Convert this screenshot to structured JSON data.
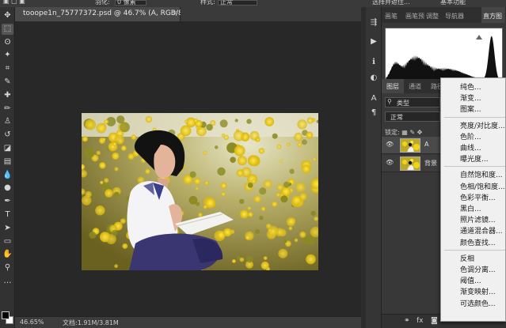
{
  "options_bar": {
    "feather_label": "羽化:",
    "feather_value": "0 像素",
    "style_label": "样式:",
    "style_value": "正常",
    "select_mask_button": "选择并遮住...",
    "workspace_value": "基本功能"
  },
  "document": {
    "tab_title": "tooope1n_75777372.psd @ 46.7% (A, RGB/8#) *",
    "close_glyph": "×"
  },
  "status": {
    "zoom": "46.65%",
    "doc_info": "文档:1.91M/3.81M"
  },
  "toolbar": {
    "tools": [
      {
        "name": "move-tool-icon",
        "glyph": "✥"
      },
      {
        "name": "marquee-tool-icon",
        "glyph": "⬚"
      },
      {
        "name": "lasso-tool-icon",
        "glyph": "ʘ"
      },
      {
        "name": "magic-wand-tool-icon",
        "glyph": "✦"
      },
      {
        "name": "crop-tool-icon",
        "glyph": "⌗"
      },
      {
        "name": "eyedropper-tool-icon",
        "glyph": "✎"
      },
      {
        "name": "healing-brush-tool-icon",
        "glyph": "✚"
      },
      {
        "name": "brush-tool-icon",
        "glyph": "✏"
      },
      {
        "name": "clone-stamp-tool-icon",
        "glyph": "♙"
      },
      {
        "name": "history-brush-tool-icon",
        "glyph": "↺"
      },
      {
        "name": "eraser-tool-icon",
        "glyph": "◪"
      },
      {
        "name": "gradient-tool-icon",
        "glyph": "▤"
      },
      {
        "name": "blur-tool-icon",
        "glyph": "💧"
      },
      {
        "name": "dodge-tool-icon",
        "glyph": "●"
      },
      {
        "name": "pen-tool-icon",
        "glyph": "✒"
      },
      {
        "name": "type-tool-icon",
        "glyph": "T"
      },
      {
        "name": "path-selection-tool-icon",
        "glyph": "➤"
      },
      {
        "name": "rectangle-tool-icon",
        "glyph": "▭"
      },
      {
        "name": "hand-tool-icon",
        "glyph": "✋"
      },
      {
        "name": "zoom-tool-icon",
        "glyph": "⚲"
      },
      {
        "name": "more-tools-icon",
        "glyph": "…"
      }
    ]
  },
  "icon_column": [
    {
      "name": "history-panel-icon",
      "glyph": "⇶"
    },
    {
      "name": "play-action-icon",
      "glyph": "▶"
    },
    {
      "name": "info-panel-icon",
      "glyph": "ℹ"
    },
    {
      "name": "color-panel-icon",
      "glyph": "◐"
    },
    {
      "name": "character-panel-icon",
      "glyph": "A"
    },
    {
      "name": "paragraph-panel-icon",
      "glyph": "¶"
    }
  ],
  "histogram_panel": {
    "tabs": [
      "画笔",
      "画笔预",
      "调整",
      "导航器",
      "直方图"
    ],
    "active_tab": "直方图"
  },
  "layers_panel": {
    "tabs": [
      "图层",
      "通道",
      "路径"
    ],
    "active_tab": "图层",
    "filter_label": "类型",
    "blend_mode": "正常",
    "lock_label": "锁定:",
    "layers": [
      {
        "name": "A",
        "visible": true
      },
      {
        "name": "背景",
        "visible": true
      }
    ]
  },
  "adjustment_menu": {
    "groups": [
      [
        "纯色...",
        "渐变...",
        "图案..."
      ],
      [
        "亮度/对比度...",
        "色阶...",
        "曲线...",
        "曝光度..."
      ],
      [
        "自然饱和度...",
        "色相/饱和度...",
        "色彩平衡...",
        "黑白...",
        "照片滤镜...",
        "通道混合器...",
        "颜色查找..."
      ],
      [
        "反相",
        "色调分离...",
        "阈值...",
        "渐变映射...",
        "可选颜色..."
      ]
    ]
  },
  "colors": {
    "panel_bg": "#383838",
    "canvas_bg": "#282828",
    "menu_bg": "#f0f0f0",
    "flower_yellow": "#f2d31a"
  }
}
